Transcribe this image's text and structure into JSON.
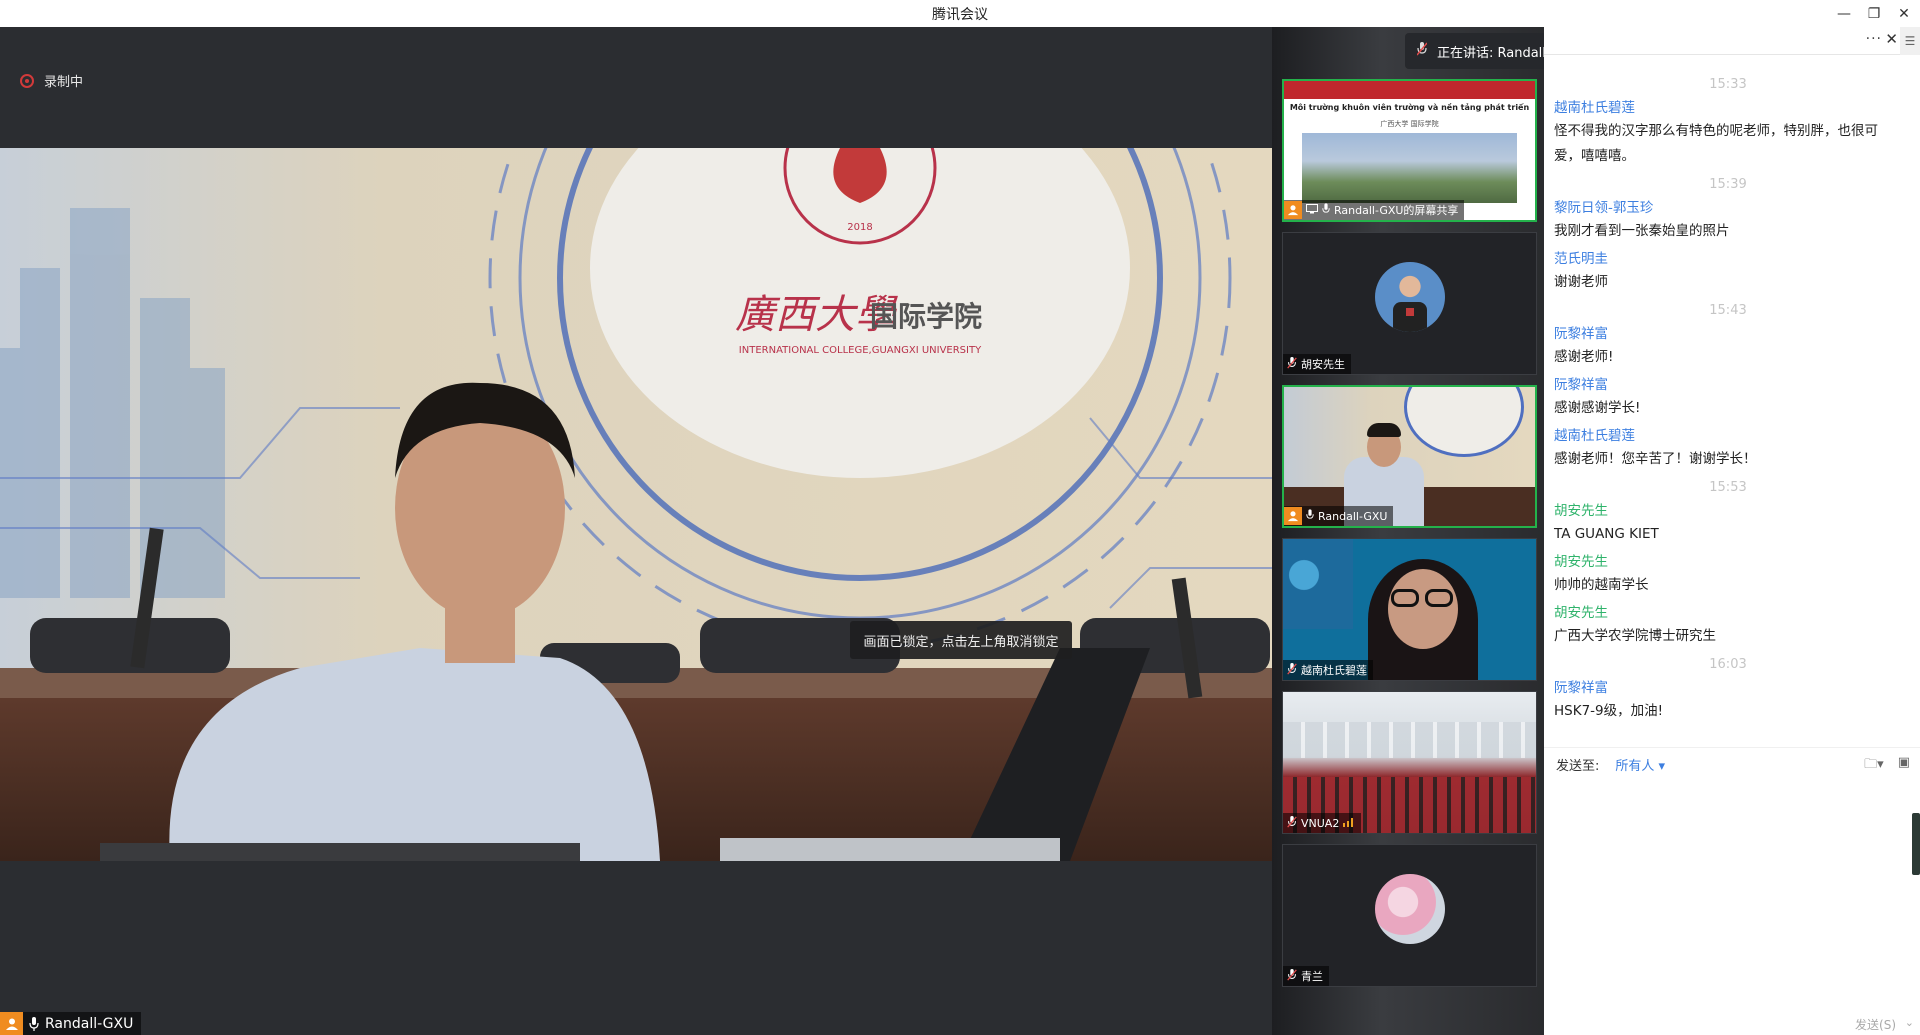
{
  "window": {
    "title": "腾讯会议",
    "minimize": "—",
    "maximize": "❐",
    "close": "✕"
  },
  "recording": {
    "label": "录制中"
  },
  "main_video": {
    "lock_toast": "画面已锁定，点击左上角取消锁定",
    "participant": "Randall-GXU",
    "scene_text": {
      "school_cn": "廣西大學",
      "college_cn": "国际学院",
      "college_en": "INTERNATIONAL COLLEGE,GUANGXI UNIVERSITY",
      "ring_text": "INTERNATIONAL COLLEGE,GUANGXI UNIVERSITY",
      "year": "2018"
    }
  },
  "speaking": {
    "label": "正在讲话: Randall-GXU;"
  },
  "thumbnails": [
    {
      "name": "Randall-GXU的屏幕共享",
      "host": true,
      "share": true,
      "active": true,
      "slide_title": "Môi trường khuôn viên trường và nền tảng phát triển",
      "slide_sub": "广西大学 国际学院"
    },
    {
      "name": "胡安先生",
      "host": false,
      "active": false
    },
    {
      "name": "Randall-GXU",
      "host": true,
      "active": true
    },
    {
      "name": "越南杜氏碧莲",
      "host": false,
      "active": false
    },
    {
      "name": "VNUA2",
      "host": false,
      "active": false
    },
    {
      "name": "青兰",
      "host": false,
      "active": false
    }
  ],
  "chat": {
    "messages": [
      {
        "type": "time",
        "value": "15:33"
      },
      {
        "type": "msg",
        "sender": "越南杜氏碧莲",
        "color": "blue",
        "text": "怪不得我的汉字那么有特色的呢老师，特别胖，也很可爱，嘻嘻嘻。"
      },
      {
        "type": "time",
        "value": "15:39"
      },
      {
        "type": "msg",
        "sender": "黎阮日领-郭玉珍",
        "color": "blue",
        "text": "我刚才看到一张秦始皇的照片"
      },
      {
        "type": "msg",
        "sender": "范氏明圭",
        "color": "blue",
        "text": "谢谢老师"
      },
      {
        "type": "time",
        "value": "15:43"
      },
      {
        "type": "msg",
        "sender": "阮黎祥富",
        "color": "blue",
        "text": "感谢老师!"
      },
      {
        "type": "msg",
        "sender": "阮黎祥富",
        "color": "blue",
        "text": "感谢感谢学长!"
      },
      {
        "type": "msg",
        "sender": "越南杜氏碧莲",
        "color": "blue",
        "text": "感谢老师！您辛苦了！谢谢学长！"
      },
      {
        "type": "time",
        "value": "15:53"
      },
      {
        "type": "msg",
        "sender": "胡安先生",
        "color": "green",
        "text": "TA GUANG KIET"
      },
      {
        "type": "msg",
        "sender": "胡安先生",
        "color": "green",
        "text": "帅帅的越南学长"
      },
      {
        "type": "msg",
        "sender": "胡安先生",
        "color": "green",
        "text": "广西大学农学院博士研究生"
      },
      {
        "type": "time",
        "value": "16:03"
      },
      {
        "type": "msg",
        "sender": "阮黎祥富",
        "color": "blue",
        "text": "HSK7-9级，加油!"
      }
    ],
    "send_to_label": "发送至:",
    "send_to_value": "所有人",
    "send_button": "发送(S)",
    "more": "···"
  },
  "colors": {
    "accent_blue": "#3d7fe0",
    "accent_green": "#2fb36b",
    "active_border": "#24b24b",
    "host_orange": "#f08c20"
  }
}
